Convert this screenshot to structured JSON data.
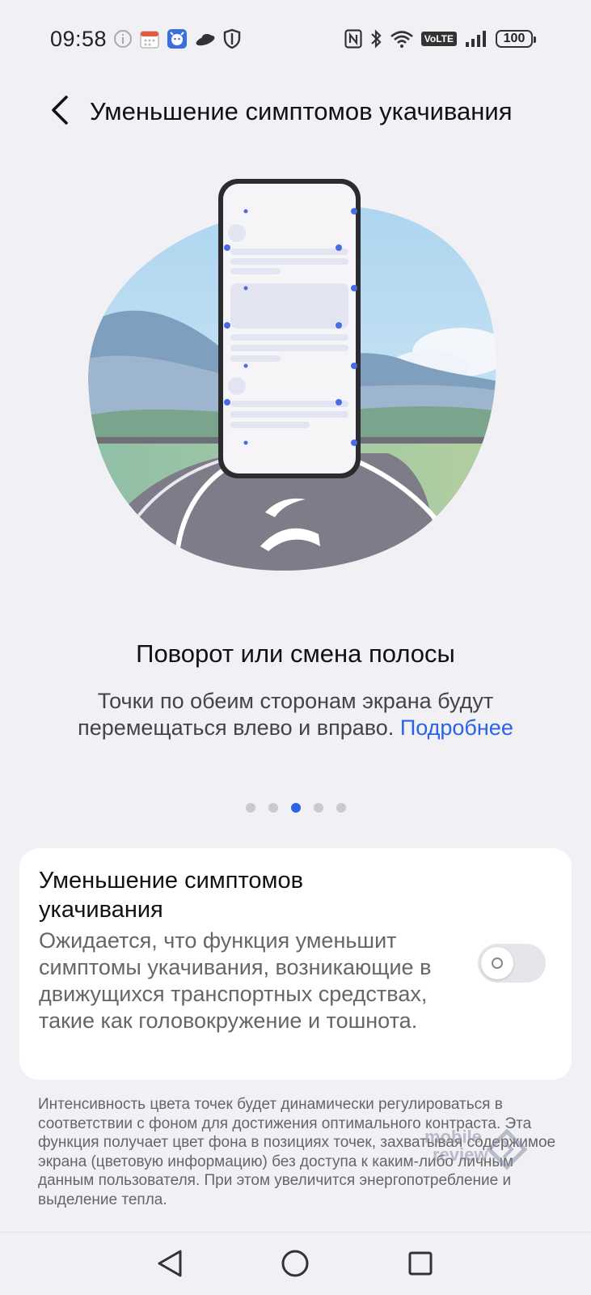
{
  "status_bar": {
    "time": "09:58",
    "volte": "VoLTE",
    "battery": "100"
  },
  "header": {
    "title": "Уменьшение симптомов укачивания"
  },
  "slide": {
    "title": "Поворот или смена полосы",
    "description": "Точки по обеим сторонам экрана будут перемещаться влево и вправо.",
    "link": "Подробнее"
  },
  "pager": {
    "count": 5,
    "active_index": 2
  },
  "setting": {
    "title": "Уменьшение симптомов укачивания",
    "description": "Ожидается, что функция уменьшит симптомы укачивания, возникающие в движущихся транспортных средствах, такие как головокружение и тошнота.",
    "enabled": false
  },
  "note": "Интенсивность цвета точек будет динамически регулироваться в соответствии с фоном для достижения оптимального контраста. Эта функция получает цвет фона в позициях точек, захватывая содержимое экрана (цветовую информацию) без доступа к каким-либо личным данным пользователя. При этом увеличится энергопотребление и выделение тепла.",
  "watermark": {
    "line1": "mobile",
    "line2": "review"
  },
  "colors": {
    "accent": "#2a63e6",
    "background": "#f1f1f5"
  }
}
